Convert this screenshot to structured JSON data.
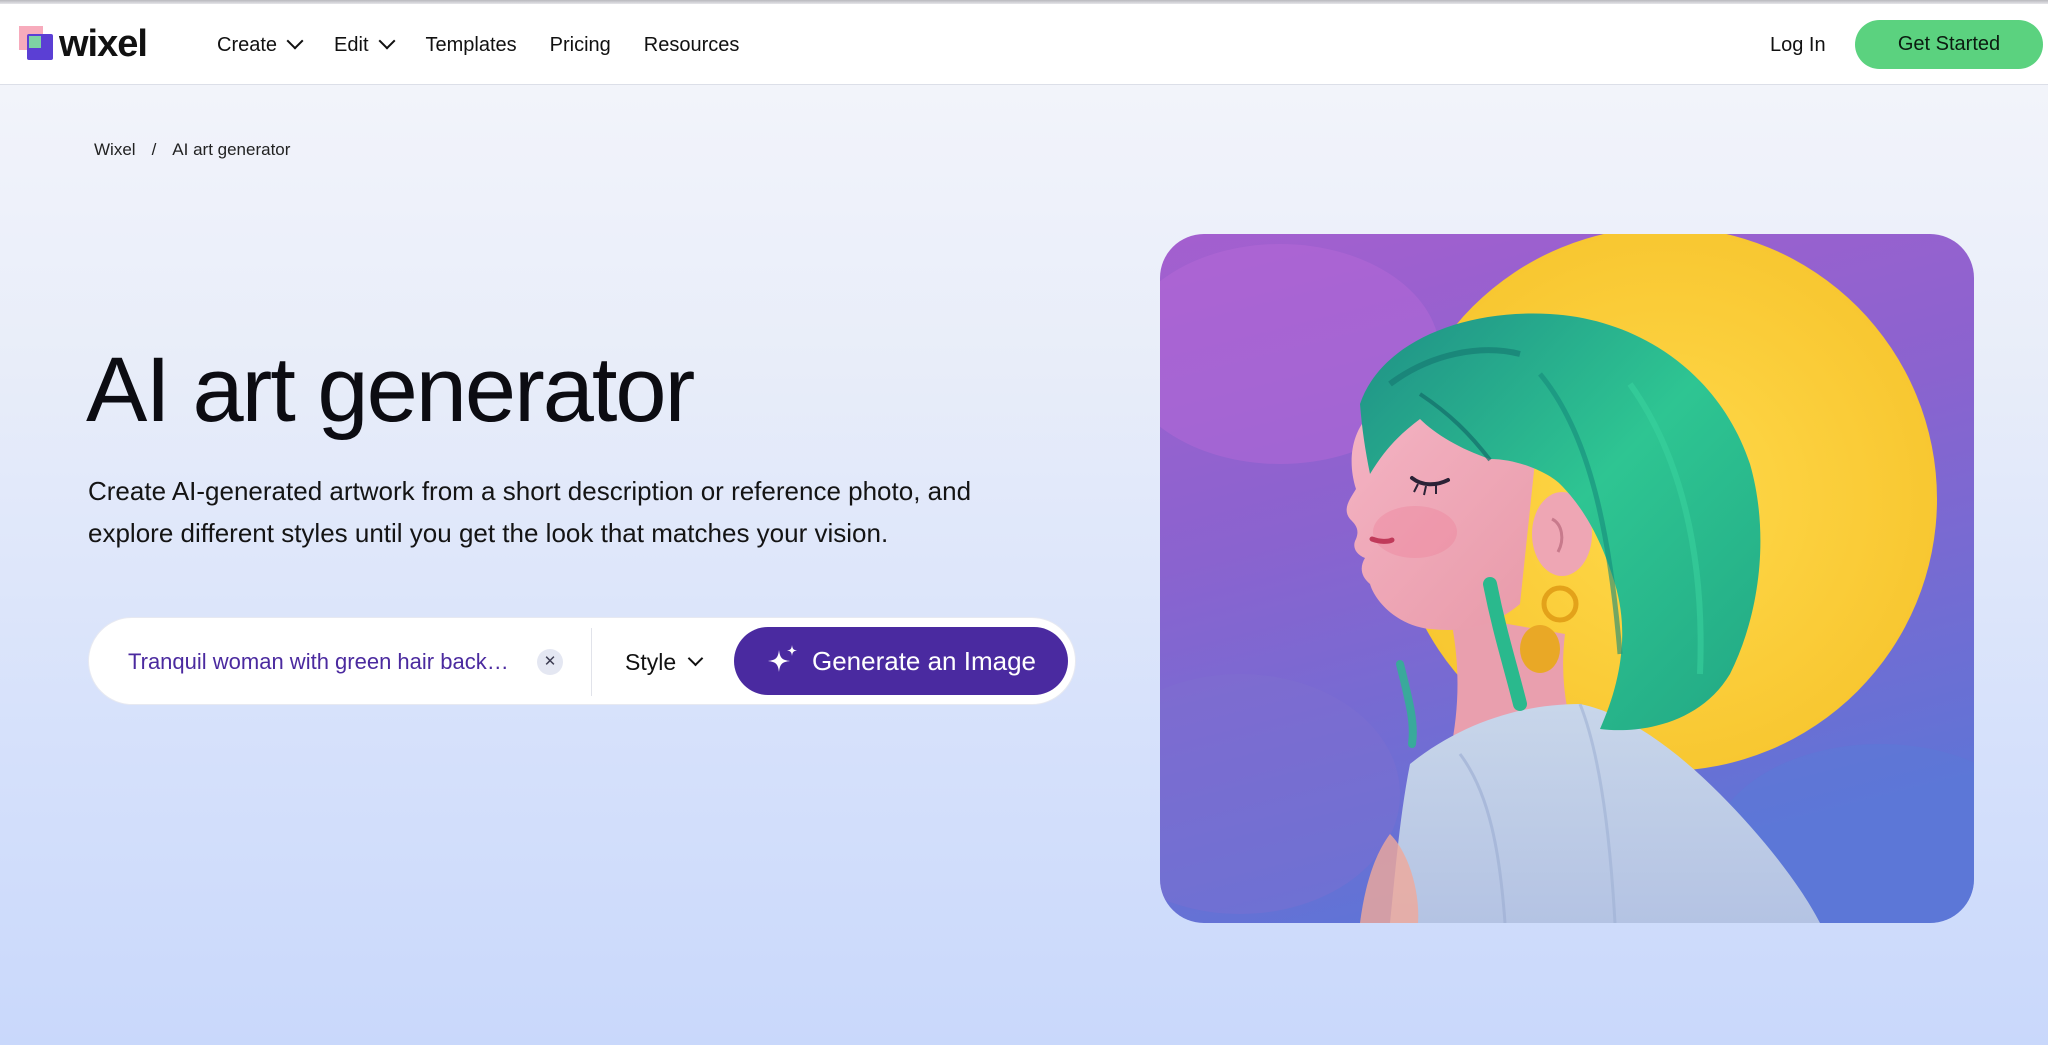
{
  "header": {
    "logo_text": "wixel",
    "nav": [
      {
        "label": "Create",
        "has_dropdown": true
      },
      {
        "label": "Edit",
        "has_dropdown": true
      },
      {
        "label": "Templates",
        "has_dropdown": false
      },
      {
        "label": "Pricing",
        "has_dropdown": false
      },
      {
        "label": "Resources",
        "has_dropdown": false
      }
    ],
    "login_label": "Log In",
    "cta_label": "Get Started"
  },
  "breadcrumb": {
    "home": "Wixel",
    "separator": "/",
    "current": "AI art generator"
  },
  "hero": {
    "title": "AI art generator",
    "subtitle": "Create AI-generated artwork from a short description or reference photo, and explore different styles until you get the look that matches your vision.",
    "prompt": {
      "value": "Tranquil woman with green hair back…",
      "clear_icon": "close-icon"
    },
    "style_label": "Style",
    "generate_label": "Generate an Image",
    "generate_icon": "sparkle-icon",
    "image_subject": "illustration of a woman with green bob hair in profile before a yellow moon"
  },
  "colors": {
    "brand_purple": "#4a2aa0",
    "cta_green": "#5bd27f",
    "prompt_text": "#4b2a9f"
  }
}
